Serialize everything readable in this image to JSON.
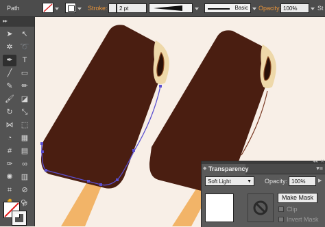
{
  "control_bar": {
    "object_type": "Path",
    "stroke_label": "Stroke:",
    "stroke_weight": "2 pt",
    "profile_label": "Basic",
    "opacity_label": "Opacity:",
    "opacity_value": "100%",
    "style_label": "St"
  },
  "toolbar": {
    "tools": [
      "selection-tool",
      "direct-selection-tool",
      "magic-wand-tool",
      "lasso-tool",
      "pen-tool",
      "type-tool",
      "line-tool",
      "rectangle-tool",
      "paintbrush-tool",
      "pencil-tool",
      "blob-brush-tool",
      "eraser-tool",
      "rotate-tool",
      "scale-tool",
      "width-tool",
      "free-transform-tool",
      "shape-builder-tool",
      "perspective-grid-tool",
      "mesh-tool",
      "gradient-tool",
      "eyedropper-tool",
      "blend-tool",
      "symbol-sprayer-tool",
      "column-graph-tool",
      "artboard-tool",
      "slice-tool",
      "hand-tool",
      "zoom-tool"
    ]
  },
  "transparency_panel": {
    "title": "Transparency",
    "blend_mode": "Soft Light",
    "opacity_label": "Opacity:",
    "opacity_value": "100%",
    "make_mask_button": "Make Mask",
    "clip_label": "Clip",
    "invert_mask_label": "Invert Mask"
  },
  "colors": {
    "chocolate": "#4a1e11",
    "stick": "#f2b468",
    "canvas": "#f8efe7",
    "path_selection": "#5a4fd0",
    "ui_accent": "#e8943a"
  }
}
